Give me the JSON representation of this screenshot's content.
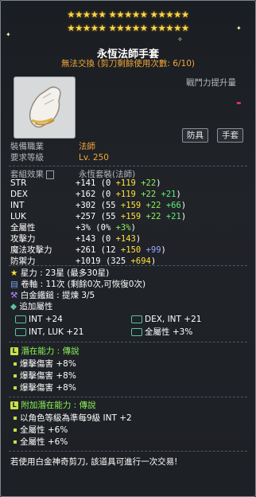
{
  "stars": {
    "row1": "★★★★★ ★★★★★ ★★★★★",
    "row2": "★★★★★ ★★★★★ ★★★★★"
  },
  "item": {
    "name": "永恆法師手套",
    "trade_note": "無法交換 (剪刀剩餘使用次數: 6/10)",
    "power_label": "戰鬥力提升量",
    "power_value": "-",
    "tag_type": "防具",
    "tag_slot": "手套",
    "job_label": "裝備職業",
    "job_value": "法師",
    "level_label": "要求等級",
    "level_value": "Lv. 250",
    "set_label": "套組效果",
    "set_value": "永恆套裝(法師)"
  },
  "stats": [
    {
      "label": "STR",
      "total": "+141",
      "base": "(0 ",
      "a": "+119",
      "b": " +22",
      "c": "",
      "close": ")"
    },
    {
      "label": "DEX",
      "total": "+162",
      "base": "(0 ",
      "a": "+119",
      "b": " +22",
      "c": " +21",
      "close": ")"
    },
    {
      "label": "INT",
      "total": "+302",
      "base": "(55 ",
      "a": "+159",
      "b": " +22",
      "c": " +66",
      "close": ")"
    },
    {
      "label": "LUK",
      "total": "+257",
      "base": "(55 ",
      "a": "+159",
      "b": " +22",
      "c": " +21",
      "close": ")"
    },
    {
      "label": "全屬性",
      "total": "+3%",
      "base": "(0% ",
      "a": "",
      "b": "+3%",
      "c": "",
      "close": ")"
    },
    {
      "label": "攻擊力",
      "total": "+143",
      "base": "(0 ",
      "a": "+143",
      "b": "",
      "c": "",
      "close": ")"
    },
    {
      "label": "魔法攻擊力",
      "total": "+261",
      "base": "(12 ",
      "a": "+150",
      "b": "",
      "c": "",
      "close": " +99)"
    },
    {
      "label": "防禦力",
      "total": "+1019",
      "base": "(325 ",
      "a": "+694",
      "b": "",
      "c": "",
      "close": ")"
    }
  ],
  "extras": {
    "star_force": "星力 : 23星 (最多30星)",
    "scroll": "卷軸 : 11次 (剩餘0次,可恢復0次)",
    "hammer": "白金鐵鎚 : 提煉 3/5",
    "bonus_label": "追加屬性",
    "bonus": [
      {
        "text": "INT +24"
      },
      {
        "text": "DEX, INT +21"
      },
      {
        "text": "INT, LUK +21"
      },
      {
        "text": "全屬性 +3%"
      }
    ]
  },
  "potential": {
    "label": "潛在能力 : 傳說",
    "badge": "L",
    "lines": [
      "爆擊傷害 +8%",
      "爆擊傷害 +8%",
      "爆擊傷害 +8%"
    ]
  },
  "additional": {
    "label": "附加潛在能力 : 傳說",
    "badge": "L",
    "lines": [
      "以角色等級為準每9級 INT +2",
      "全屬性 +6%",
      "全屬性 +6%"
    ]
  },
  "footer": "若使用白金神奇剪刀, 該道具可進行一次交易!",
  "colors": {
    "gold": "#f7d64a",
    "orange": "#f2a73a",
    "green": "#8cf25a",
    "yellow": "#ffe13a",
    "blue": "#9aa8ff"
  }
}
